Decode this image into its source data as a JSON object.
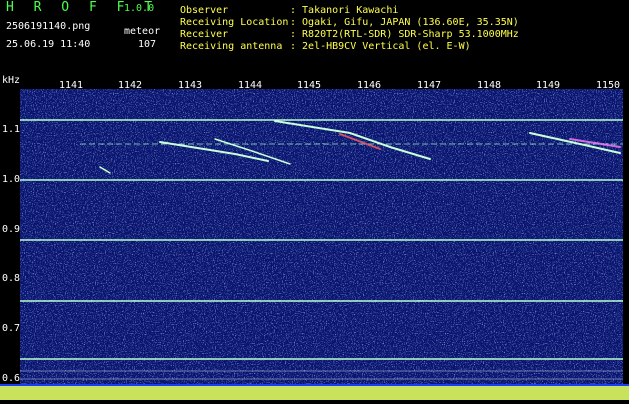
{
  "header": {
    "app_title": "H R O F F T",
    "version": "1.0.0",
    "filename": "2506191140.png",
    "classification": "meteor",
    "timestamp": "25.06.19 11:40",
    "count": "107",
    "info": [
      {
        "label": "Observer",
        "value": ": Takanori Kawachi"
      },
      {
        "label": "Receiving Location",
        "value": ": Ogaki, Gifu, JAPAN (136.60E, 35.35N)"
      },
      {
        "label": "Receiver",
        "value": ": R820T2(RTL-SDR) SDR-Sharp 53.1000MHz"
      },
      {
        "label": "Receiving antenna",
        "value": ": 2el-HB9CV Vertical (el. E-W)"
      }
    ]
  },
  "axes": {
    "y_unit": "kHz",
    "x_ticks": [
      "1141",
      "1142",
      "1143",
      "1144",
      "1145",
      "1146",
      "1147",
      "1148",
      "1149",
      "1150"
    ],
    "y_ticks": [
      "1.1",
      "1.0",
      "0.9",
      "0.8",
      "0.7",
      "0.6"
    ]
  },
  "colors": {
    "background": "#000000",
    "plot_bg": "#0a1470",
    "title_green": "#4cff4c",
    "info_yellow": "#ffff4c",
    "trace": "#c8ffd8"
  }
}
